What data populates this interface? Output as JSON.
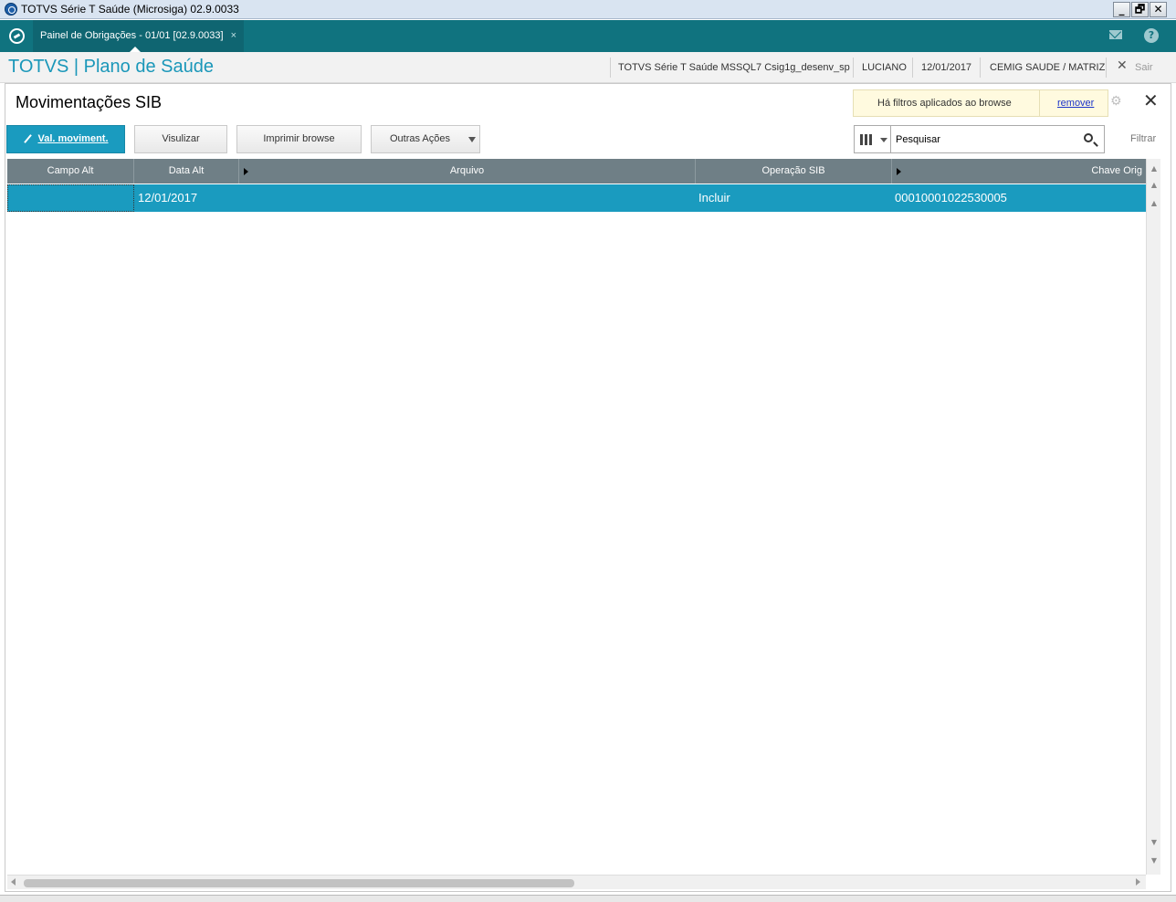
{
  "window": {
    "title": "TOTVS Série T Saúde (Microsiga) 02.9.0033",
    "minimize": "_",
    "restore": "🗗",
    "close": "✕"
  },
  "tabbar": {
    "tab_label": "Painel de Obrigações - 01/01 [02.9.0033]",
    "tab_close": "×",
    "mail_icon": "mail-icon",
    "help_label": "?"
  },
  "header": {
    "brand": "TOTVS | Plano de Saúde",
    "environment": "TOTVS Série T Saúde MSSQL7 Csig1g_desenv_sp",
    "user": "LUCIANO",
    "date": "12/01/2017",
    "company": "CEMIG SAUDE / MATRIZ",
    "exit_label": "Sair"
  },
  "panel": {
    "title": "Movimentações SIB",
    "filter_notice": "Há filtros aplicados ao browse",
    "filter_remove": "remover"
  },
  "toolbar": {
    "primary_label": "Val. moviment.",
    "view_label": "Visulizar",
    "print_label": "Imprimir browse",
    "more_label": "Outras Ações",
    "search_placeholder": "Pesquisar",
    "search_value": "Pesquisar",
    "filter_label": "Filtrar"
  },
  "grid": {
    "columns": [
      "Campo Alt",
      "Data Alt",
      "Arquivo",
      "Operação SIB",
      "Chave Orig"
    ],
    "rows": [
      {
        "campo_alt": "",
        "data_alt": "12/01/2017",
        "arquivo": "",
        "operacao_sib": "Incluir",
        "chave_orig": "00010001022530005"
      }
    ]
  },
  "colors": {
    "teal_bar": "#10737f",
    "accent": "#1a9bbf",
    "brand_text": "#1a97b9",
    "grid_header": "#6f7f86",
    "notice_bg": "#fffadf"
  }
}
